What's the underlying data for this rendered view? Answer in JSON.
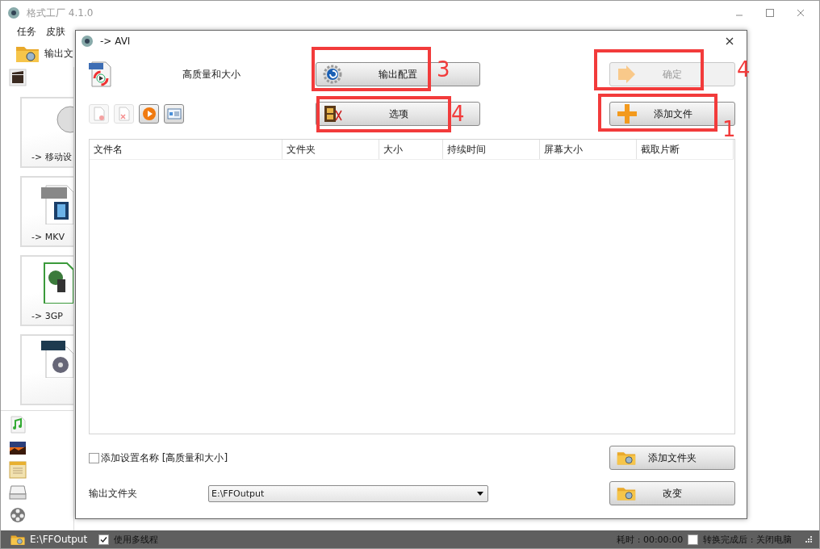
{
  "window": {
    "title": "格式工厂 4.1.0"
  },
  "menu": [
    "任务",
    "皮肤"
  ],
  "toolbar": {
    "label": "输出文"
  },
  "sidebar": {
    "cards": [
      {
        "label": "-> 移动设"
      },
      {
        "label": "-> MKV",
        "kind": "mkv"
      },
      {
        "label": "-> 3GP",
        "kind": "phone"
      },
      {
        "kind": "mpeg"
      }
    ]
  },
  "dialog": {
    "title": "-> AVI",
    "profile": "高质量和大小",
    "buttons": [
      {
        "label": "输出配置",
        "kind": "gear",
        "disabled": false
      },
      {
        "label": "确定",
        "kind": "arrow",
        "disabled": true
      },
      {
        "label": "选项",
        "kind": "film",
        "disabled": false
      },
      {
        "label": "添加文件",
        "kind": "plus",
        "disabled": false
      }
    ],
    "tools": [
      {
        "kind": "remove",
        "disabled": true
      },
      {
        "kind": "clear",
        "disabled": true
      },
      {
        "kind": "play",
        "disabled": false
      },
      {
        "kind": "info",
        "disabled": false
      }
    ],
    "table": {
      "columns": [
        "文件名",
        "文件夹",
        "大小",
        "持续时间",
        "屏幕大小",
        "截取片断"
      ]
    },
    "add_name": {
      "label": "添加设置名称 [高质量和大小]",
      "checked": false
    },
    "add_folder_button": "添加文件夹",
    "output": {
      "label": "输出文件夹",
      "value": "E:\\FFOutput"
    },
    "change_button": "改变"
  },
  "annotations": [
    {
      "label": "3"
    },
    {
      "label": "4"
    },
    {
      "label": "4"
    },
    {
      "label": "1"
    }
  ],
  "status_bar": {
    "path": "E:\\FFOutput",
    "multithread": {
      "label": "使用多线程",
      "checked": true
    },
    "elapsed": "耗时 : 00:00:00",
    "shutdown": {
      "label": "转换完成后 : 关闭电脑",
      "checked": false
    }
  }
}
